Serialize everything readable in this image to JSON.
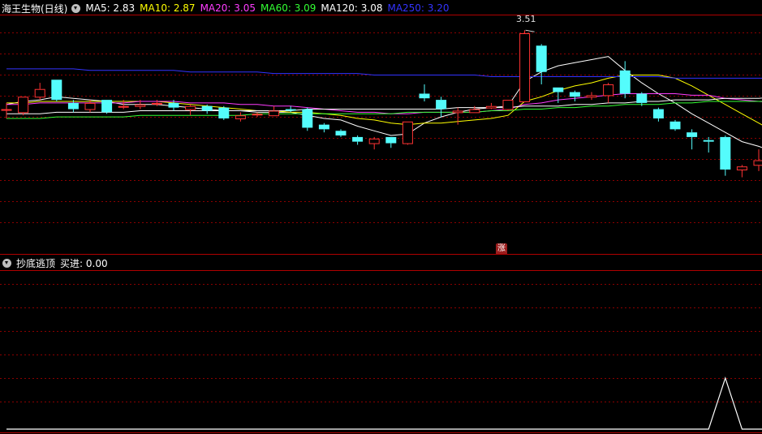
{
  "main_header": {
    "stock_name": "海王生物(日线)",
    "ma_labels": [
      {
        "text": "MA5: 2.83",
        "color": "#ffffff"
      },
      {
        "text": "MA10: 2.87",
        "color": "#ffff00"
      },
      {
        "text": "MA20: 3.05",
        "color": "#ff3cff"
      },
      {
        "text": "MA60: 3.09",
        "color": "#33ff33"
      },
      {
        "text": "MA120: 3.08",
        "color": "#ffffff"
      },
      {
        "text": "MA250: 3.20",
        "color": "#3333ff"
      }
    ]
  },
  "indicator_header": {
    "name": "抄底逃顶",
    "value_text": "买进: 0.00"
  },
  "peak_label": "3.51",
  "rise_badge": "涨",
  "colors": {
    "up": "#ff3333",
    "down": "#54fcfc",
    "background": "#000000",
    "panel_border": "#b00000",
    "grid": "#8b0000",
    "indicator_line": "#ffffff"
  },
  "chart_data": [
    {
      "type": "candlestick",
      "ylim": [
        2.5,
        3.6
      ],
      "candles": [
        [
          3.0,
          3.0,
          3.04,
          2.94
        ],
        [
          2.98,
          3.08,
          3.08,
          2.96
        ],
        [
          3.08,
          3.13,
          3.17,
          3.06
        ],
        [
          3.19,
          3.06,
          3.19,
          3.05
        ],
        [
          3.04,
          3.0,
          3.06,
          2.98
        ],
        [
          3.0,
          3.04,
          3.06,
          2.98
        ],
        [
          3.06,
          2.98,
          3.06,
          2.97
        ],
        [
          3.02,
          3.02,
          3.06,
          3.0
        ],
        [
          3.02,
          3.03,
          3.06,
          3.0
        ],
        [
          3.04,
          3.04,
          3.06,
          3.02
        ],
        [
          3.04,
          3.01,
          3.06,
          2.99
        ],
        [
          3.0,
          3.02,
          3.03,
          2.96
        ],
        [
          3.02,
          2.99,
          3.03,
          2.97
        ],
        [
          3.01,
          2.94,
          3.02,
          2.93
        ],
        [
          2.94,
          2.96,
          2.98,
          2.92
        ],
        [
          2.97,
          2.97,
          2.98,
          2.95
        ],
        [
          2.96,
          2.99,
          3.02,
          2.96
        ],
        [
          3.0,
          2.99,
          3.02,
          2.98
        ],
        [
          3.0,
          2.88,
          3.01,
          2.86
        ],
        [
          2.9,
          2.87,
          2.91,
          2.85
        ],
        [
          2.86,
          2.83,
          2.87,
          2.82
        ],
        [
          2.82,
          2.79,
          2.83,
          2.77
        ],
        [
          2.78,
          2.81,
          2.82,
          2.74
        ],
        [
          2.82,
          2.78,
          2.82,
          2.75
        ],
        [
          2.78,
          2.92,
          2.92,
          2.77
        ],
        [
          3.1,
          3.07,
          3.16,
          3.05
        ],
        [
          3.06,
          3.0,
          3.08,
          2.95
        ],
        [
          2.98,
          2.99,
          3.01,
          2.9
        ],
        [
          2.98,
          3.0,
          3.02,
          2.98
        ],
        [
          3.01,
          3.02,
          3.04,
          3.0
        ],
        [
          3.0,
          3.06,
          3.06,
          2.99
        ],
        [
          3.05,
          3.49,
          3.51,
          3.05
        ],
        [
          3.41,
          3.24,
          3.42,
          3.16
        ],
        [
          3.14,
          3.11,
          3.14,
          3.04
        ],
        [
          3.11,
          3.08,
          3.12,
          3.05
        ],
        [
          3.08,
          3.09,
          3.11,
          3.06
        ],
        [
          3.09,
          3.16,
          3.17,
          3.04
        ],
        [
          3.25,
          3.1,
          3.31,
          3.07
        ],
        [
          3.1,
          3.04,
          3.11,
          3.02
        ],
        [
          3.0,
          2.94,
          3.01,
          2.92
        ],
        [
          2.92,
          2.87,
          2.93,
          2.86
        ],
        [
          2.85,
          2.82,
          2.87,
          2.74
        ],
        [
          2.8,
          2.79,
          2.82,
          2.72
        ],
        [
          2.82,
          2.61,
          2.83,
          2.57
        ],
        [
          2.61,
          2.63,
          2.64,
          2.56
        ],
        [
          2.64,
          2.67,
          2.74,
          2.6
        ],
        [
          2.67,
          2.73,
          2.75,
          2.65
        ]
      ],
      "ma": [
        {
          "name": "MA5",
          "color": "#ffffff",
          "values": [
            3.03,
            3.05,
            3.06,
            3.08,
            3.07,
            3.06,
            3.05,
            3.03,
            3.03,
            3.03,
            3.02,
            3.01,
            3.0,
            2.99,
            2.99,
            2.98,
            2.98,
            2.98,
            2.96,
            2.94,
            2.93,
            2.89,
            2.86,
            2.83,
            2.84,
            2.91,
            2.95,
            2.98,
            3.0,
            3.01,
            3.02,
            3.18,
            3.24,
            3.28,
            3.3,
            3.32,
            3.34,
            3.25,
            3.17,
            3.1,
            3.04,
            2.97,
            2.91,
            2.85,
            2.79,
            2.76,
            2.72
          ]
        },
        {
          "name": "MA10",
          "color": "#ffff00",
          "values": [
            3.04,
            3.04,
            3.05,
            3.05,
            3.05,
            3.05,
            3.05,
            3.05,
            3.05,
            3.05,
            3.04,
            3.03,
            3.02,
            3.01,
            3.0,
            2.99,
            2.99,
            2.98,
            2.98,
            2.97,
            2.96,
            2.94,
            2.93,
            2.91,
            2.9,
            2.91,
            2.91,
            2.92,
            2.93,
            2.94,
            2.96,
            3.05,
            3.08,
            3.12,
            3.15,
            3.17,
            3.2,
            3.22,
            3.22,
            3.22,
            3.2,
            3.15,
            3.09,
            3.03,
            2.97,
            2.91,
            2.85
          ]
        },
        {
          "name": "MA20",
          "color": "#ff3cff",
          "values": [
            3.03,
            3.03,
            3.04,
            3.04,
            3.04,
            3.04,
            3.04,
            3.04,
            3.05,
            3.05,
            3.05,
            3.04,
            3.04,
            3.04,
            3.03,
            3.03,
            3.02,
            3.02,
            3.01,
            3.0,
            2.99,
            2.98,
            2.98,
            2.97,
            2.97,
            2.98,
            2.98,
            2.98,
            2.98,
            2.99,
            3.0,
            3.03,
            3.04,
            3.06,
            3.07,
            3.08,
            3.09,
            3.1,
            3.1,
            3.1,
            3.1,
            3.09,
            3.09,
            3.07,
            3.06,
            3.05,
            3.04
          ]
        },
        {
          "name": "MA60",
          "color": "#33ff33",
          "values": [
            2.94,
            2.94,
            2.94,
            2.95,
            2.95,
            2.95,
            2.95,
            2.95,
            2.96,
            2.96,
            2.96,
            2.96,
            2.96,
            2.96,
            2.96,
            2.97,
            2.97,
            2.97,
            2.97,
            2.97,
            2.97,
            2.97,
            2.97,
            2.97,
            2.98,
            2.98,
            2.98,
            2.98,
            2.98,
            2.99,
            2.99,
            3.0,
            3.0,
            3.01,
            3.01,
            3.02,
            3.02,
            3.03,
            3.03,
            3.03,
            3.04,
            3.04,
            3.05,
            3.05,
            3.05,
            3.05,
            3.05
          ]
        },
        {
          "name": "MA120",
          "color": "#ffffff",
          "values": [
            2.97,
            2.97,
            2.97,
            2.98,
            2.98,
            2.98,
            2.98,
            2.98,
            2.99,
            2.99,
            2.99,
            2.99,
            2.99,
            2.99,
            2.99,
            2.99,
            2.99,
            2.99,
            3.0,
            3.0,
            3.0,
            3.0,
            3.0,
            3.0,
            3.0,
            3.0,
            3.0,
            3.01,
            3.01,
            3.01,
            3.01,
            3.02,
            3.02,
            3.02,
            3.03,
            3.03,
            3.04,
            3.04,
            3.05,
            3.05,
            3.06,
            3.06,
            3.06,
            3.07,
            3.07,
            3.07,
            3.08
          ]
        },
        {
          "name": "MA250",
          "color": "#3333ff",
          "values": [
            3.26,
            3.26,
            3.26,
            3.26,
            3.26,
            3.25,
            3.25,
            3.25,
            3.25,
            3.25,
            3.25,
            3.24,
            3.24,
            3.24,
            3.24,
            3.24,
            3.23,
            3.23,
            3.23,
            3.23,
            3.23,
            3.23,
            3.22,
            3.22,
            3.22,
            3.22,
            3.22,
            3.22,
            3.22,
            3.21,
            3.21,
            3.21,
            3.21,
            3.21,
            3.21,
            3.21,
            3.21,
            3.21,
            3.21,
            3.21,
            3.2,
            3.2,
            3.2,
            3.2,
            3.2,
            3.2,
            3.2
          ]
        }
      ]
    },
    {
      "type": "line",
      "series": [
        {
          "values": [
            0,
            0,
            0,
            0,
            0,
            0,
            0,
            0,
            0,
            0,
            0,
            0,
            0,
            0,
            0,
            0,
            0,
            0,
            0,
            0,
            0,
            0,
            0,
            0,
            0,
            0,
            0,
            0,
            0,
            0,
            0,
            0,
            0,
            0,
            0,
            0,
            0,
            0,
            0,
            0,
            0,
            0,
            0,
            1,
            0,
            0,
            0
          ]
        }
      ],
      "ylim": [
        0,
        1
      ]
    }
  ]
}
